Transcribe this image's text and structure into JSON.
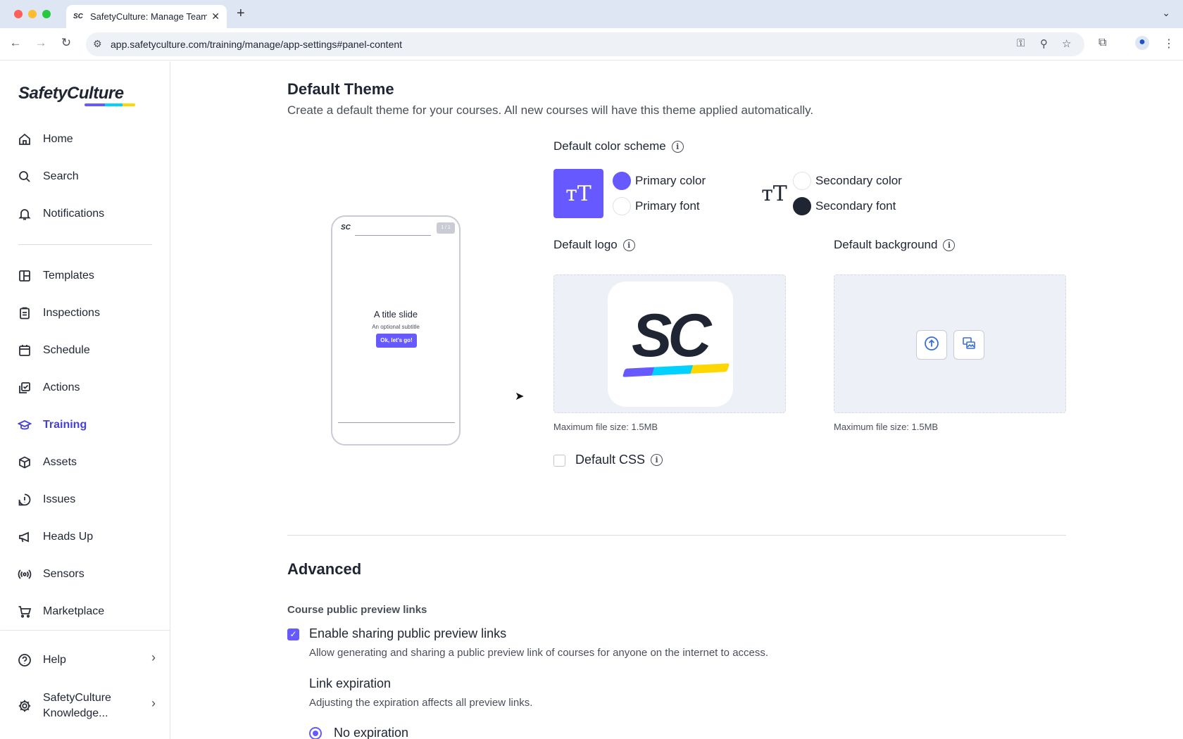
{
  "browser": {
    "tab_title": "SafetyCulture: Manage Teams",
    "tab_favicon": "SC",
    "url": "app.safetyculture.com/training/manage/app-settings#panel-content"
  },
  "sidebar": {
    "logo": "SafetyCulture",
    "items": [
      {
        "label": "Home",
        "icon": "home-icon"
      },
      {
        "label": "Search",
        "icon": "search-icon"
      },
      {
        "label": "Notifications",
        "icon": "bell-icon"
      },
      {
        "label": "Templates",
        "icon": "templates-icon"
      },
      {
        "label": "Inspections",
        "icon": "clipboard-icon"
      },
      {
        "label": "Schedule",
        "icon": "calendar-icon"
      },
      {
        "label": "Actions",
        "icon": "actions-icon"
      },
      {
        "label": "Training",
        "icon": "graduation-cap-icon"
      },
      {
        "label": "Assets",
        "icon": "cube-icon"
      },
      {
        "label": "Issues",
        "icon": "alert-icon"
      },
      {
        "label": "Heads Up",
        "icon": "megaphone-icon"
      },
      {
        "label": "Sensors",
        "icon": "sensor-icon"
      },
      {
        "label": "Marketplace",
        "icon": "cart-icon"
      }
    ],
    "help_label": "Help",
    "org_line1": "SafetyCulture",
    "org_line2": "Knowledge..."
  },
  "theme": {
    "title": "Default Theme",
    "subtitle": "Create a default theme for your courses. All new courses will have this theme applied automatically.",
    "color_scheme_label": "Default color scheme",
    "swatch_glyph": "тT",
    "primary_color_label": "Primary color",
    "primary_font_label": "Primary font",
    "secondary_color_label": "Secondary color",
    "secondary_font_label": "Secondary font",
    "colors": {
      "primary": "#6559ff",
      "primary_font": "#ffffff",
      "secondary": "#ffffff",
      "secondary_font": "#1f2533"
    },
    "logo_label": "Default logo",
    "logo_text": "SC",
    "background_label": "Default background",
    "max_file_size": "Maximum file size: 1.5MB",
    "css_label": "Default CSS"
  },
  "preview": {
    "logo": "SC",
    "counter": "1 / 1",
    "title": "A title slide",
    "subtitle": "An optional subtitle",
    "button": "Ok, let's go!"
  },
  "advanced": {
    "title": "Advanced",
    "section_label": "Course public preview links",
    "enable_label": "Enable sharing public preview links",
    "enable_desc": "Allow generating and sharing a public preview link of courses for anyone on the internet to access.",
    "expiration_title": "Link expiration",
    "expiration_desc": "Adjusting the expiration affects all preview links.",
    "no_expiration": "No expiration"
  }
}
